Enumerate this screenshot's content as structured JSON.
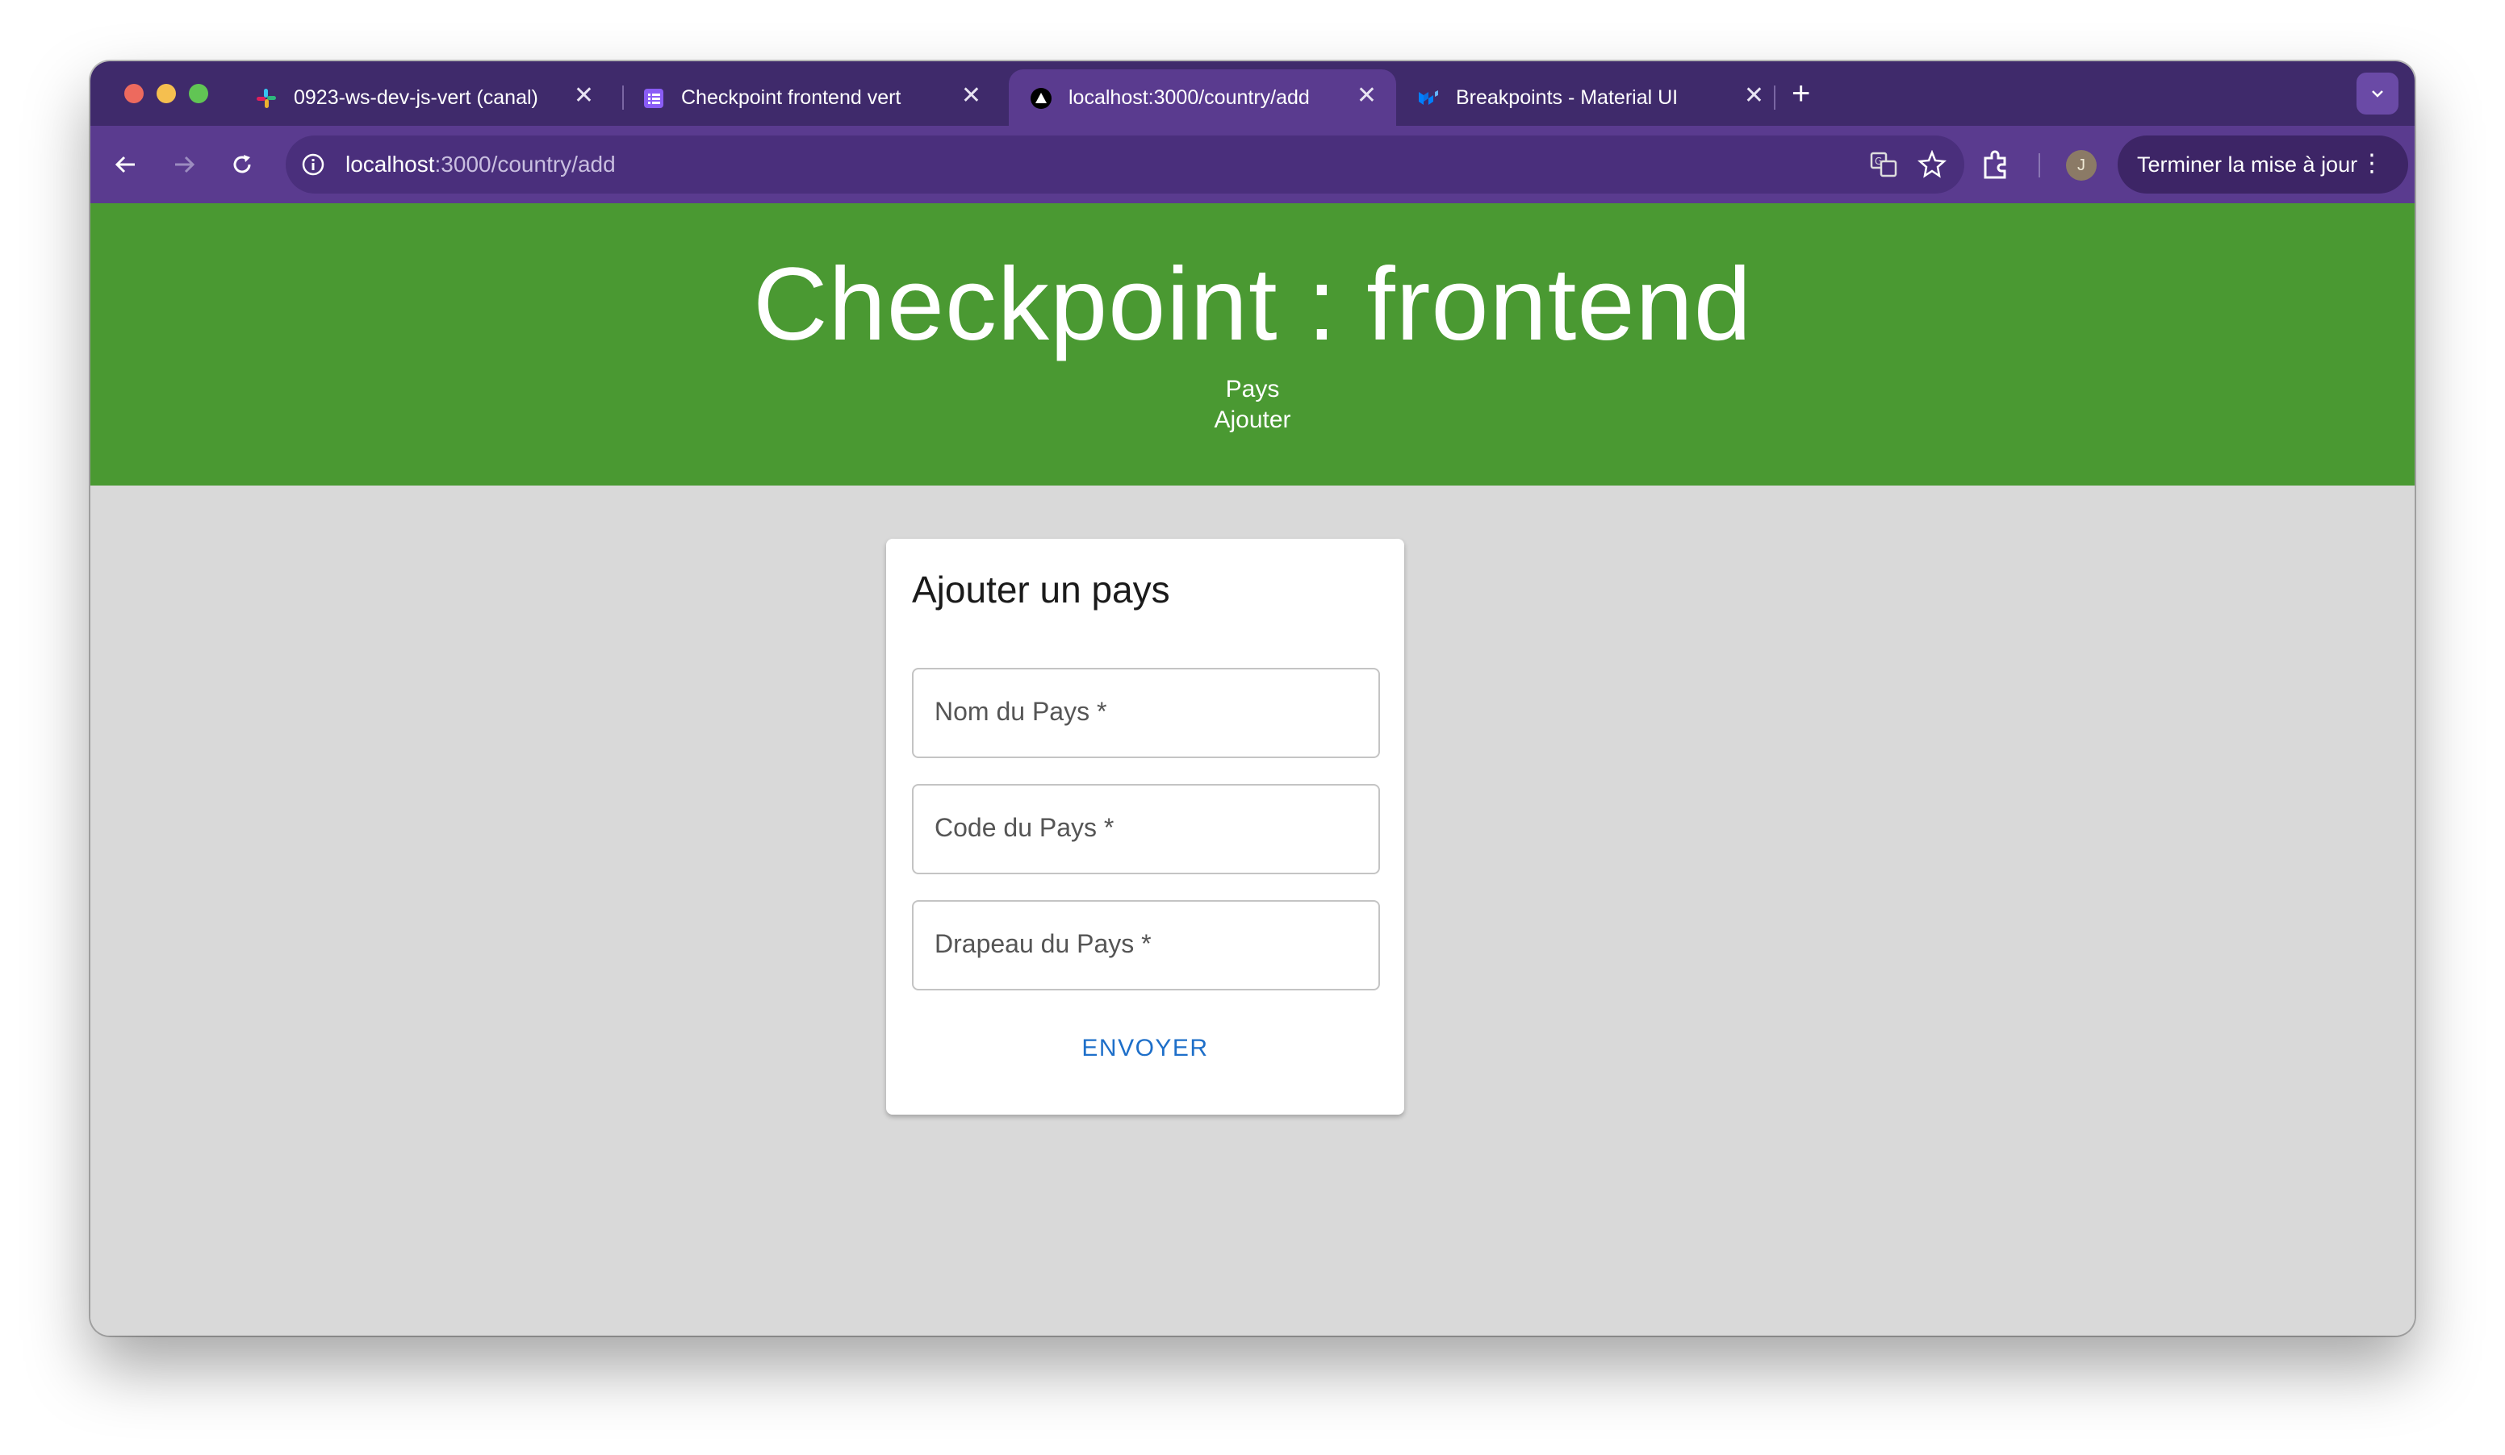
{
  "browser": {
    "tabs": [
      {
        "title": "0923-ws-dev-js-vert (canal)",
        "icon": "slack-icon",
        "active": false
      },
      {
        "title": "Checkpoint frontend vert",
        "icon": "list-doc-icon",
        "active": false
      },
      {
        "title": "localhost:3000/country/add",
        "icon": "app-favicon-icon",
        "active": true
      },
      {
        "title": "Breakpoints - Material UI",
        "icon": "mui-logo-icon",
        "active": false
      }
    ],
    "tab_close_glyph": "✕",
    "new_tab_glyph": "+",
    "address_host": "localhost",
    "address_path": ":3000/country/add",
    "avatar_initial": "J",
    "update_button": "Terminer la mise à jour",
    "kebab_glyph": "⋮",
    "colors": {
      "tabstrip": "#3f2a6b",
      "toolbar": "#5a3b8f",
      "omnibox": "#4a2f7c"
    }
  },
  "app": {
    "title": "Checkpoint : frontend",
    "nav": {
      "countries": "Pays",
      "add": "Ajouter"
    },
    "header_color": "#4a9932"
  },
  "form": {
    "heading": "Ajouter un pays",
    "fields": [
      {
        "label": "Nom du Pays *",
        "value": ""
      },
      {
        "label": "Code du Pays *",
        "value": ""
      },
      {
        "label": "Drapeau du Pays *",
        "value": ""
      }
    ],
    "submit": "ENVOYER",
    "submit_color": "#1e6fc9"
  }
}
